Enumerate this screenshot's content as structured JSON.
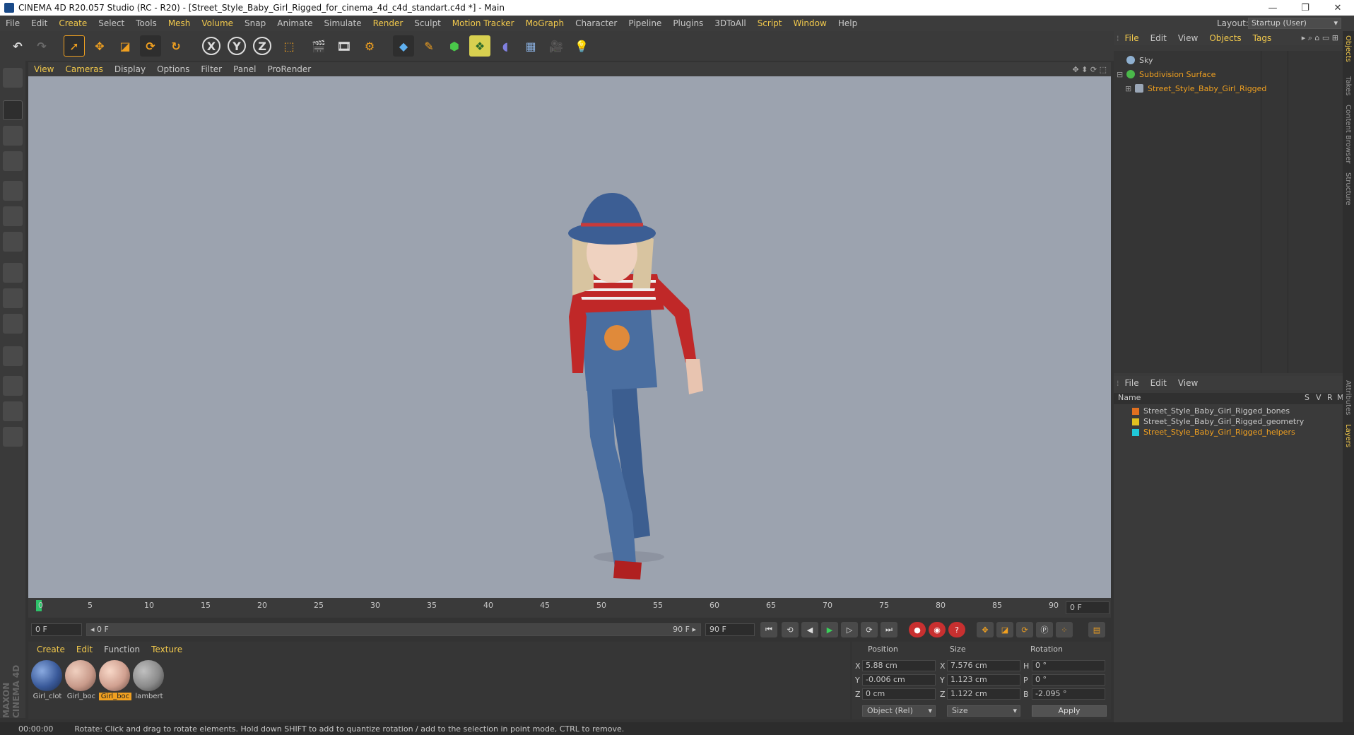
{
  "window": {
    "title": "CINEMA 4D R20.057 Studio (RC - R20) - [Street_Style_Baby_Girl_Rigged_for_cinema_4d_c4d_standart.c4d *] - Main",
    "minimize": "—",
    "maximize": "❐",
    "close": "✕"
  },
  "menubar": {
    "items": [
      {
        "label": "File"
      },
      {
        "label": "Edit"
      },
      {
        "label": "Create"
      },
      {
        "label": "Select"
      },
      {
        "label": "Tools"
      },
      {
        "label": "Mesh"
      },
      {
        "label": "Volume"
      },
      {
        "label": "Snap"
      },
      {
        "label": "Animate"
      },
      {
        "label": "Simulate"
      },
      {
        "label": "Render"
      },
      {
        "label": "Sculpt"
      },
      {
        "label": "Motion Tracker"
      },
      {
        "label": "MoGraph"
      },
      {
        "label": "Character"
      },
      {
        "label": "Pipeline"
      },
      {
        "label": "Plugins"
      },
      {
        "label": "3DToAll"
      },
      {
        "label": "Script"
      },
      {
        "label": "Window"
      },
      {
        "label": "Help"
      }
    ],
    "layout_label": "Layout:",
    "layout_value": "Startup (User)"
  },
  "toolbar": {
    "axis_x": "X",
    "axis_y": "Y",
    "axis_z": "Z"
  },
  "viewport": {
    "menu": [
      {
        "label": "View"
      },
      {
        "label": "Cameras"
      },
      {
        "label": "Display"
      },
      {
        "label": "Options"
      },
      {
        "label": "Filter"
      },
      {
        "label": "Panel"
      },
      {
        "label": "ProRender"
      }
    ]
  },
  "timeline": {
    "ticks": [
      "0",
      "5",
      "10",
      "15",
      "20",
      "25",
      "30",
      "35",
      "40",
      "45",
      "50",
      "55",
      "60",
      "65",
      "70",
      "75",
      "80",
      "85",
      "90"
    ],
    "current_frame_field": "0 F"
  },
  "transport": {
    "start_field": "0 F",
    "range_start": "◂ 0 F",
    "range_end": "90 F ▸",
    "end_field": "90 F"
  },
  "materials": {
    "menu": [
      {
        "label": "Create"
      },
      {
        "label": "Edit"
      },
      {
        "label": "Function"
      },
      {
        "label": "Texture"
      }
    ],
    "items": [
      {
        "name": "Girl_clot",
        "color": "#3a5a9a"
      },
      {
        "name": "Girl_boc",
        "color": "#c89a8a"
      },
      {
        "name": "Girl_boc",
        "color": "#d0a090",
        "selected": true
      },
      {
        "name": "lambert",
        "color": "#8a8a8a"
      }
    ]
  },
  "coords": {
    "position_header": "Position",
    "size_header": "Size",
    "rotation_header": "Rotation",
    "rows": [
      {
        "axis": "X",
        "pos": "5.88 cm",
        "size_axis": "X",
        "size": "7.576 cm",
        "rot_axis": "H",
        "rot": "0 °"
      },
      {
        "axis": "Y",
        "pos": "-0.006 cm",
        "size_axis": "Y",
        "size": "1.123 cm",
        "rot_axis": "P",
        "rot": "0 °"
      },
      {
        "axis": "Z",
        "pos": "0 cm",
        "size_axis": "Z",
        "size": "1.122 cm",
        "rot_axis": "B",
        "rot": "-2.095 °"
      }
    ],
    "mode_dropdown": "Object (Rel)",
    "size_dropdown": "Size",
    "apply_label": "Apply"
  },
  "status": {
    "time": "00:00:00",
    "message": "Rotate: Click and drag to rotate elements. Hold down SHIFT to add to quantize rotation / add to the selection in point mode, CTRL to remove."
  },
  "object_manager": {
    "menu": [
      {
        "label": "File"
      },
      {
        "label": "Edit"
      },
      {
        "label": "View"
      },
      {
        "label": "Objects"
      },
      {
        "label": "Tags"
      }
    ],
    "objects": [
      {
        "name": "Sky",
        "color": "#c8c8c8",
        "icon": "#8fb0d0"
      },
      {
        "name": "Subdivision Surface",
        "color": "#f0a020",
        "icon": "#4ab84a"
      },
      {
        "name": "Street_Style_Baby_Girl_Rigged",
        "color": "#f0a020",
        "icon": "#9aa6b6"
      }
    ]
  },
  "layer_manager": {
    "menu": [
      {
        "label": "File"
      },
      {
        "label": "Edit"
      },
      {
        "label": "View"
      }
    ],
    "header": {
      "name": "Name",
      "s": "S",
      "v": "V",
      "r": "R",
      "m": "M"
    },
    "layers": [
      {
        "name": "Street_Style_Baby_Girl_Rigged_bones",
        "color": "#c8c8c8",
        "swatch": "#e07020"
      },
      {
        "name": "Street_Style_Baby_Girl_Rigged_geometry",
        "color": "#c8c8c8",
        "swatch": "#e0c020"
      },
      {
        "name": "Street_Style_Baby_Girl_Rigged_helpers",
        "color": "#f0a020",
        "swatch": "#20c8d8"
      }
    ]
  },
  "side_tabs": [
    {
      "label": "Objects"
    },
    {
      "label": "Takes"
    },
    {
      "label": "Content Browser"
    },
    {
      "label": "Structure"
    },
    {
      "label": "Attributes"
    },
    {
      "label": "Layers"
    }
  ]
}
